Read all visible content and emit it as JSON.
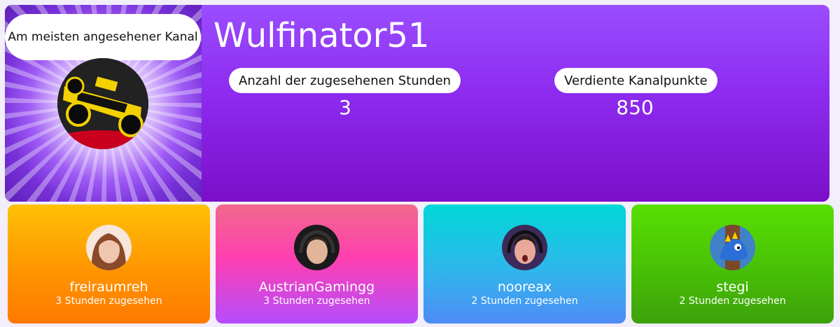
{
  "featured": {
    "badge": "Am meisten angesehener Kanal",
    "channel_name": "Wulfinator51",
    "stats": [
      {
        "label": "Anzahl der zugesehenen Stunden",
        "value": "3"
      },
      {
        "label": "Verdiente Kanalpunkte",
        "value": "850"
      }
    ]
  },
  "users": [
    {
      "name": "freiraumreh",
      "hours": "3 Stunden zugesehen"
    },
    {
      "name": "AustrianGamingg",
      "hours": "3 Stunden zugesehen"
    },
    {
      "name": "nooreax",
      "hours": "2 Stunden zugesehen"
    },
    {
      "name": "stegi",
      "hours": "2 Stunden zugesehen"
    }
  ],
  "colors": {
    "featured_gradient": [
      "#9a4dff",
      "#7b0fc9"
    ],
    "card1": [
      "#ffc107",
      "#ff7a00"
    ],
    "card2": [
      "#f06a8c",
      "#b44dff"
    ],
    "card3": [
      "#00d8d8",
      "#4f8cf5"
    ],
    "card4": [
      "#58e000",
      "#3da10c"
    ]
  }
}
